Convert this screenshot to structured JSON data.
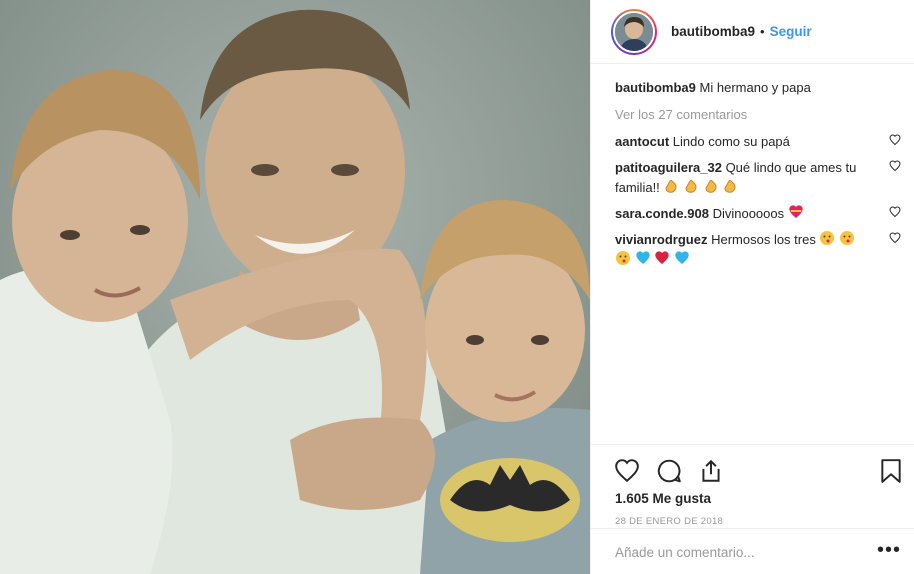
{
  "post": {
    "image_alt": "Foto de un hombre con dos niños",
    "header": {
      "username": "bautibomba9",
      "separator": "•",
      "follow_label": "Seguir"
    },
    "caption": {
      "username": "bautibomba9",
      "text": "Mi hermano y papa"
    },
    "view_all_label": "Ver los 27 comentarios",
    "comments": [
      {
        "username": "aantocut",
        "text": "Lindo como su papá",
        "emoji": []
      },
      {
        "username": "patitoaguilera_32",
        "text": "Qué lindo que ames tu familia!!",
        "emoji": [
          "clap",
          "clap",
          "clap",
          "clap"
        ]
      },
      {
        "username": "sara.conde.908",
        "text": "Divinooooos",
        "emoji": [
          "heart-red"
        ]
      },
      {
        "username": "vivianrodrguez",
        "text": "Hermosos los tres",
        "emoji": [
          "kiss",
          "kiss",
          "kiss",
          "heart-blue",
          "heart-red",
          "heart-blue"
        ]
      }
    ],
    "likes": "1.605 Me gusta",
    "date": "28 DE ENERO DE 2018",
    "comment_placeholder": "Añade un comentario...",
    "more_label": "•••",
    "icons": {
      "like": "heart-outline-icon",
      "comment": "speech-bubble-icon",
      "share": "share-icon",
      "save": "bookmark-icon",
      "comment_like": "small-heart-icon"
    },
    "colors": {
      "link": "#3897f0",
      "muted": "#999999",
      "text": "#262626",
      "border": "#efefef"
    }
  }
}
